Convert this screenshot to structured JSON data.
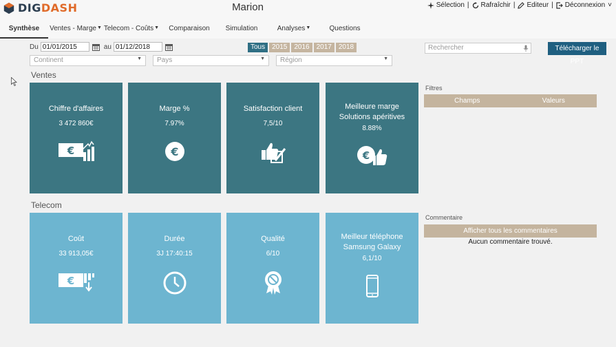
{
  "header": {
    "logo_text_a": "DIG",
    "logo_text_b": "DASH",
    "page_title": "Marion",
    "actions": [
      {
        "label": "Sélection",
        "icon": "selection-icon"
      },
      {
        "label": "Rafraîchir",
        "icon": "refresh-icon"
      },
      {
        "label": "Editeur",
        "icon": "pencil-icon"
      },
      {
        "label": "Déconnexion",
        "icon": "logout-icon"
      }
    ]
  },
  "tabs": [
    {
      "label": "Synthèse",
      "active": true,
      "dropdown": false
    },
    {
      "label": "Ventes - Marge",
      "active": false,
      "dropdown": true
    },
    {
      "label": "Telecom - Coûts",
      "active": false,
      "dropdown": true
    },
    {
      "label": "Comparaison",
      "active": false,
      "dropdown": false
    },
    {
      "label": "Simulation",
      "active": false,
      "dropdown": false
    },
    {
      "label": "Analyses",
      "active": false,
      "dropdown": true
    },
    {
      "label": "Questions",
      "active": false,
      "dropdown": false
    }
  ],
  "filters": {
    "from_label": "Du",
    "from_value": "01/01/2015",
    "to_label": "au",
    "to_value": "01/12/2018",
    "years": [
      {
        "label": "Tous",
        "active": true
      },
      {
        "label": "2015",
        "active": false
      },
      {
        "label": "2016",
        "active": false
      },
      {
        "label": "2017",
        "active": false
      },
      {
        "label": "2018",
        "active": false
      }
    ],
    "search_placeholder": "Rechercher",
    "ppt_button": "Télécharger le PPT",
    "selects": [
      "Continent",
      "Pays",
      "Région"
    ]
  },
  "ventes": {
    "title": "Ventes",
    "cards": [
      {
        "title": "Chiffre d'affaires",
        "value": "3 472 860€",
        "icon": "euro-chart-icon"
      },
      {
        "title": "Marge %",
        "value": "7.97%",
        "icon": "euro-coin-icon"
      },
      {
        "title": "Satisfaction client",
        "value": "7,5/10",
        "icon": "thumbs-up-check-icon"
      },
      {
        "title": "Meilleure marge",
        "subtitle": "Solutions apéritives",
        "value": "8.88%",
        "icon": "euro-thumbs-up-icon"
      }
    ]
  },
  "telecom": {
    "title": "Telecom",
    "cards": [
      {
        "title": "Coût",
        "value": "33 913,05€",
        "icon": "euro-down-icon"
      },
      {
        "title": "Durée",
        "value": "3J 17:40:15",
        "icon": "clock-icon"
      },
      {
        "title": "Qualité",
        "value": "6/10",
        "icon": "quality-badge-icon"
      },
      {
        "title": "Meilleur téléphone",
        "subtitle": "Samsung Galaxy",
        "value": "6,1/10",
        "icon": "smartphone-icon"
      }
    ]
  },
  "panel": {
    "filters_label": "Filtres",
    "col_fields": "Champs",
    "col_values": "Valeurs",
    "comment_label": "Commentaire",
    "comment_button": "Afficher tous les commentaires",
    "no_comment": "Aucun commentaire trouvé."
  },
  "colors": {
    "ventes_card": "#3c7682",
    "telecom_card": "#6db5d0",
    "accent_button": "#1f5f80",
    "beige": "#c4b49e"
  }
}
